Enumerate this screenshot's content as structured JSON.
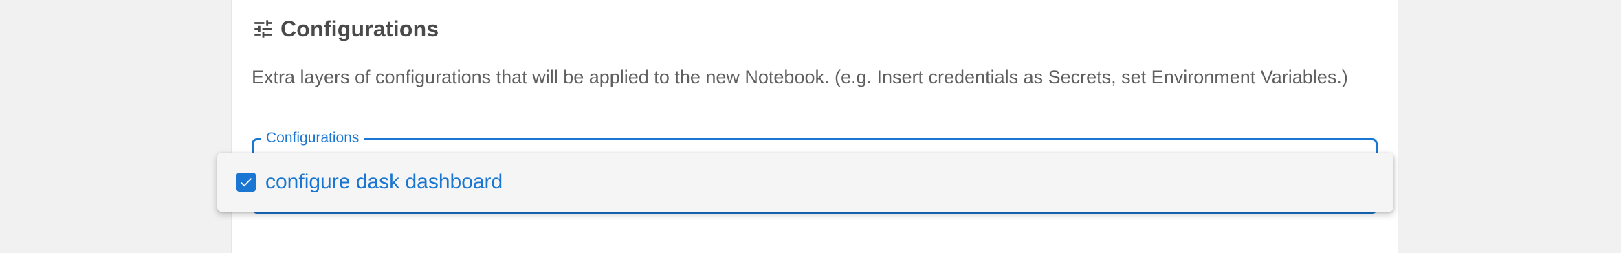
{
  "section": {
    "title": "Configurations",
    "icon": "tune-icon",
    "description": "Extra layers of configurations that will be applied to the new Notebook. (e.g. Insert credentials as Secrets, set Environment Variables.)"
  },
  "configurations_field": {
    "label": "Configurations"
  },
  "dropdown": {
    "options": [
      {
        "label": "configure dask dashboard",
        "checked": true
      }
    ]
  },
  "colors": {
    "accent": "#1976d2",
    "title_text": "#4a4a4a",
    "body_text": "#5f5f5f",
    "panel_bg": "#f5f5f5"
  }
}
